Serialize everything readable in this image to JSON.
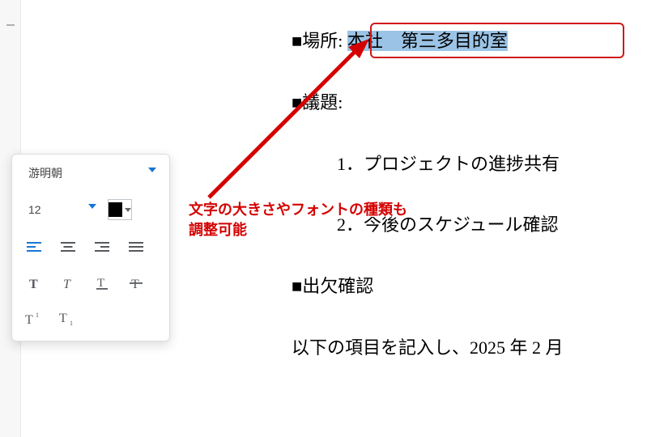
{
  "document": {
    "location_label": "■場所:",
    "location_value": "本社　第三多目的室",
    "agenda_label": "■議題:",
    "agenda_items": [
      "1．プロジェクトの進捗共有",
      "2．今後のスケジュール確認"
    ],
    "attendance_label": "■出欠確認",
    "footer_text": "以下の項目を記入し、2025 年 2 月"
  },
  "toolbar": {
    "font_name": "游明朝",
    "font_size": "12",
    "color_hex": "#000000"
  },
  "annotation": {
    "line1": "文字の大きさやフォントの種類も",
    "line2": "調整可能"
  }
}
